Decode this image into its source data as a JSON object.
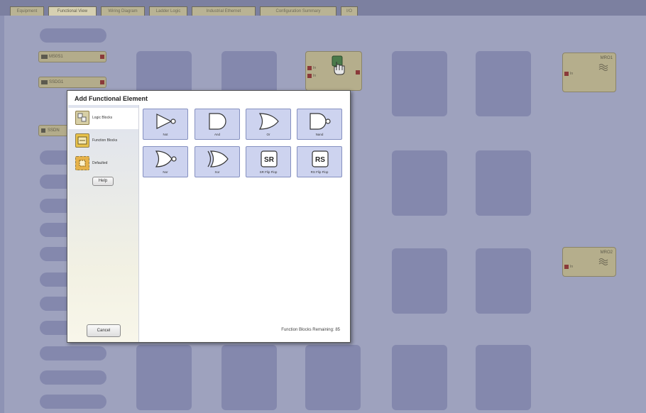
{
  "tabs": [
    {
      "label": "Equipment",
      "active": false
    },
    {
      "label": "Functional View",
      "active": true
    },
    {
      "label": "Wiring Diagram",
      "active": false
    },
    {
      "label": "Ladder Logic",
      "active": false
    },
    {
      "label": "Industrial Ethernet",
      "active": false
    },
    {
      "label": "Configuration Summary",
      "active": false
    },
    {
      "label": "I/O",
      "active": false
    }
  ],
  "canvas": {
    "inputs": [
      {
        "label": "MS0S1"
      },
      {
        "label": "SSDG1"
      },
      {
        "label": "SSDN"
      }
    ],
    "outputs": [
      {
        "title": "MRO1",
        "pin": "In"
      },
      {
        "title": "MRO2",
        "pin": "In"
      }
    ],
    "logic_pins": [
      "In",
      "In"
    ]
  },
  "dialog": {
    "title": "Add Functional Element",
    "categories": [
      {
        "label": "Logic Blocks",
        "icon": "logic-blocks-icon",
        "selected": true
      },
      {
        "label": "Function Blocks",
        "icon": "function-blocks-icon",
        "selected": false
      },
      {
        "label": "Defaulted",
        "icon": "defaulted-icon",
        "selected": false
      }
    ],
    "help_label": "Help",
    "cancel_label": "Cancel",
    "remaining_text": "Function Blocks Remaining: 85",
    "elements": [
      {
        "label": "Not",
        "icon": "not-gate-icon"
      },
      {
        "label": "And",
        "icon": "and-gate-icon"
      },
      {
        "label": "Or",
        "icon": "or-gate-icon"
      },
      {
        "label": "Nand",
        "icon": "nand-gate-icon"
      },
      {
        "label": "Nor",
        "icon": "nor-gate-icon"
      },
      {
        "label": "Xor",
        "icon": "xor-gate-icon"
      },
      {
        "label": "SR Flip Flop",
        "icon": "sr-flip-flop-icon",
        "glyph": "SR"
      },
      {
        "label": "RS Flip Flop",
        "icon": "rs-flip-flop-icon",
        "glyph": "RS"
      }
    ]
  },
  "colors": {
    "overlay": "#9ea2be",
    "slot": "#8488ad",
    "io_block": "#b3ac8b",
    "element_tile": "#cdd3ef",
    "pin": "#8a3a3a"
  }
}
